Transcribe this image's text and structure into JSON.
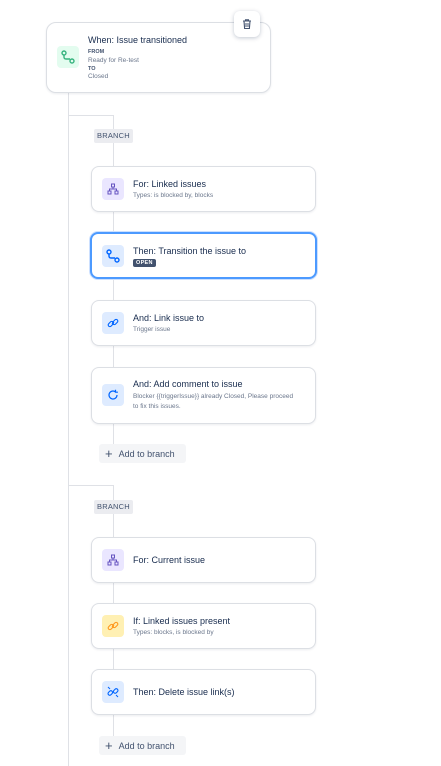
{
  "trigger": {
    "title": "When: Issue transitioned",
    "from_label": "FROM",
    "from_value": "Ready for Re-test",
    "to_label": "TO",
    "to_value": "Closed",
    "icon": "transition-icon"
  },
  "branches": [
    {
      "label": "BRANCH",
      "add_label": "Add to branch",
      "steps": [
        {
          "title": "For: Linked issues",
          "sub": "Types: is blocked by, blocks",
          "icon": "hierarchy-icon"
        },
        {
          "title": "Then: Transition the issue to",
          "lozenge": "OPEN",
          "icon": "transition-icon"
        },
        {
          "title": "And: Link issue to",
          "sub": "Trigger issue",
          "icon": "link-icon"
        },
        {
          "title": "And: Add comment to issue",
          "sub1": "Blocker {{triggerIssue}} already Closed, Please proceed",
          "sub2": "to fix this issues.",
          "icon": "refresh-icon"
        }
      ]
    },
    {
      "label": "BRANCH",
      "add_label": "Add to branch",
      "steps": [
        {
          "title": "For: Current issue",
          "icon": "hierarchy-icon"
        },
        {
          "title": "If: Linked issues present",
          "sub": "Types: blocks, is blocked by",
          "icon": "link-icon"
        },
        {
          "title": "Then: Delete issue link(s)",
          "icon": "unlink-icon"
        }
      ]
    }
  ],
  "colors": {
    "green_bg": "#e3fcef",
    "green": "#36b37e",
    "purple_bg": "#eae6ff",
    "purple": "#6554c0",
    "blue_bg": "#deebff",
    "blue": "#0065ff",
    "yellow_bg": "#fff0b3",
    "orange": "#ff991f"
  }
}
